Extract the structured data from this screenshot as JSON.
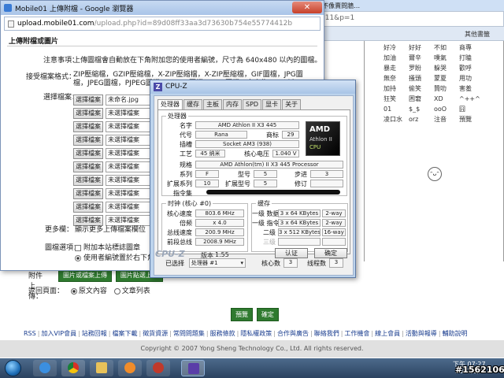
{
  "background": {
    "top_strip_text": "5不像賣問牆…",
    "url_text": "711&p=1",
    "bookmark": "其他書籤",
    "emoticons": [
      "好冷",
      "好好",
      "不如",
      "商專",
      "加油",
      "爾辛",
      "噗氣",
      "打瞌",
      "暴走",
      "罗盼",
      "躲哭",
      "歡呼",
      "無奈",
      "搔頭",
      "蒙夏",
      "用功",
      "加持",
      "偷笑",
      "贊叻",
      "害羞",
      "狂笑",
      "困窘",
      "XD",
      "^++^",
      "01",
      "$_$",
      "ooO",
      "囧",
      "凌口水",
      "orz",
      "注音",
      "預覽"
    ],
    "attach_label": "附件上傳：",
    "attach_buttons": [
      "圖片或檔案上傳",
      "圖片點選上傳"
    ],
    "return_label": "返回頁面：",
    "return_opt1": "原文內容",
    "return_opt2": "文章列表",
    "preview_buttons": [
      "預覽",
      "確定"
    ],
    "footer_links": [
      "RSS",
      "加入VIP會員",
      "站務回報",
      "檔案下載",
      "徵貨資源",
      "常問問題集",
      "服務條款",
      "隱私權政策",
      "合作與廣告",
      "聯絡我們",
      "工作機會",
      "線上會員",
      "活動與報導",
      "輔助說明"
    ],
    "copyright": "Copyright © 2007 Yong Sheng Technology Co., Ltd. All rights reserved."
  },
  "chrome": {
    "title": "Mobile01 上傳附檔 - Google 瀏覽器",
    "url_host": "upload.mobile01.com",
    "url_path": "/upload.php?id=89d08ff33aa3d73630b754e55774412b",
    "heading": "上傳附檔或圖片",
    "notes_label": "注意事項：",
    "notes_text": "上傳圖檔會自動放在下角附加您的使用者編號，尺寸為 640x480 以內的圖檔。",
    "formats_label": "接受檔案格式：",
    "formats_text": "ZIP壓縮檔，GZIP壓縮檔，X-ZIP壓縮檔，X-ZIP壓縮檔，GIF圖檔，JPG圖檔，JPEG圖檔，PJPEG圖檔，X-PNG圖檔，PNG圖檔，大小為2MB以內。",
    "choose_label": "選擇檔案：",
    "file_button": "選擇檔案",
    "files": [
      "未命名.jpg",
      "未選擇檔案",
      "未選擇檔案",
      "未選擇檔案",
      "未選擇檔案",
      "未選擇檔案",
      "未選擇檔案",
      "未選擇檔案",
      "未選擇檔案",
      "未選擇檔案"
    ],
    "more_label": "更多欄：",
    "more_link": "顯示更多上傳檔案欄位",
    "image_opt_label": "圖檔選項：",
    "opt1": "附加本站標誌圖章",
    "opt2": "使用者編號置於右下角"
  },
  "cpuz": {
    "title": "CPU-Z",
    "tabs": [
      "处理器",
      "缓存",
      "主板",
      "内存",
      "SPD",
      "显卡",
      "关于"
    ],
    "group_processor": "处理器",
    "name_label": "名字",
    "name": "AMD Athlon II X3 445",
    "code_label": "代号",
    "code": "Rana",
    "brand_label": "商标",
    "brand": "29",
    "socket_label": "插槽",
    "socket": "Socket AM3 (938)",
    "tech_label": "工艺",
    "tech": "45 纳米",
    "voltage_label": "核心电压",
    "voltage": "1.040 V",
    "spec_label": "规格",
    "spec": "AMD Athlon(tm) II X3 445 Processor",
    "family_label": "系列",
    "family": "F",
    "model_label": "型号",
    "model": "5",
    "stepping_label": "步进",
    "stepping": "3",
    "ext_family_label": "扩展系列",
    "ext_family": "10",
    "ext_model_label": "扩展型号",
    "ext_model": "5",
    "revision_label": "修订",
    "revision": "",
    "instructions_label": "指令集",
    "logo_brand": "AMD",
    "logo_line1": "Athlon II",
    "logo_line2": "CPU",
    "group_clocks": "时钟 (核心 #0)",
    "core_speed_label": "核心速度",
    "core_speed": "803.6 MHz",
    "multiplier_label": "倍频",
    "multiplier": "x 4.0",
    "bus_speed_label": "总线速度",
    "bus_speed": "200.9 MHz",
    "ht_link_label": "前段总线",
    "ht_link": "2008.9 MHz",
    "group_cache": "缓存",
    "l1d_label": "一级 数据",
    "l1d": "3 x 64 KBytes",
    "l1d_way": "2-way",
    "l1i_label": "一级 指令",
    "l1i": "3 x 64 KBytes",
    "l1i_way": "2-way",
    "l2_label": "二级",
    "l2": "3 x 512 KBytes",
    "l2_way": "16-way",
    "l3_label": "三级",
    "selection_label": "已选择",
    "selection": "处理器 #1",
    "cores_label": "核心数",
    "cores": "3",
    "threads_label": "线程数",
    "threads": "3",
    "brand_name": "CPU-Z",
    "version_label": "版本",
    "version": "1.55",
    "validate_btn": "认证",
    "ok_btn": "确定"
  },
  "taskbar": {
    "clock_time": "下午 07:27",
    "clock_date": "2011/1/3",
    "watermark": "#1562106"
  }
}
